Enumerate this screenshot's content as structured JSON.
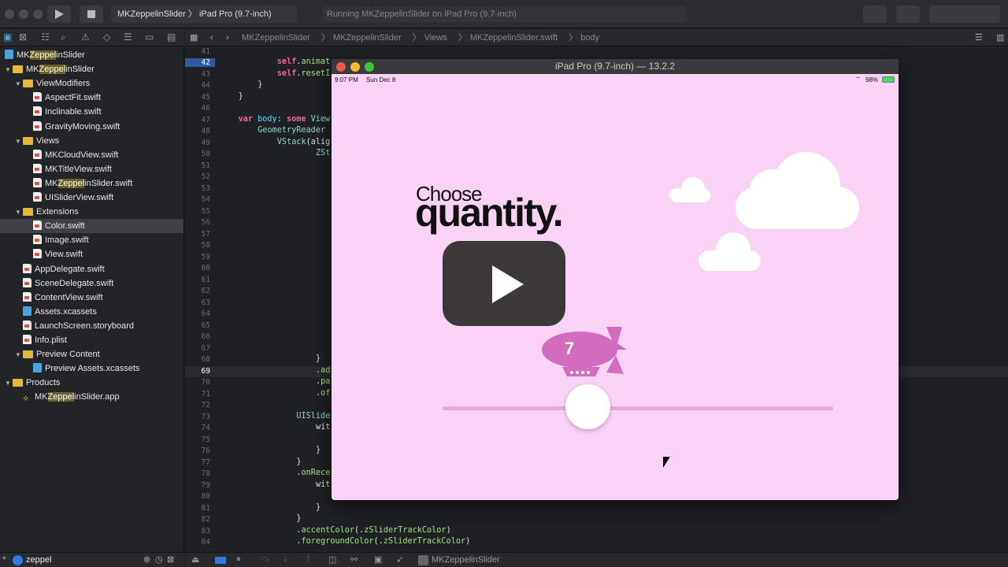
{
  "toolbar": {
    "scheme": "MKZeppelinSlider",
    "device": "iPad Pro (9.7-inch)",
    "activity": "Running MKZeppelinSlider on iPad Pro (9.7-inch)"
  },
  "jumpbar": [
    "MKZeppelinSlider",
    "MKZeppelinSlider",
    "Views",
    "MKZeppelinSlider.swift",
    "body"
  ],
  "navigator": {
    "items": [
      {
        "label": "MKZeppelinSlider",
        "type": "project",
        "level": 0,
        "disc": false
      },
      {
        "label": "MKZeppelinSlider",
        "type": "folder",
        "level": 0,
        "disc": true
      },
      {
        "label": "ViewModifiers",
        "type": "folder",
        "level": 1,
        "disc": true
      },
      {
        "label": "AspectFit.swift",
        "type": "swift",
        "level": 2
      },
      {
        "label": "Inclinable.swift",
        "type": "swift",
        "level": 2
      },
      {
        "label": "GravityMoving.swift",
        "type": "swift",
        "level": 2
      },
      {
        "label": "Views",
        "type": "folder",
        "level": 1,
        "disc": true
      },
      {
        "label": "MKCloudView.swift",
        "type": "swift",
        "level": 2
      },
      {
        "label": "MKTitleView.swift",
        "type": "swift",
        "level": 2
      },
      {
        "label": "MKZeppelinSlider.swift",
        "type": "swift",
        "level": 2
      },
      {
        "label": "UISliderView.swift",
        "type": "swift",
        "level": 2
      },
      {
        "label": "Extensions",
        "type": "folder",
        "level": 1,
        "disc": true
      },
      {
        "label": "Color.swift",
        "type": "swift",
        "level": 2,
        "selected": true
      },
      {
        "label": "Image.swift",
        "type": "swift",
        "level": 2
      },
      {
        "label": "View.swift",
        "type": "swift",
        "level": 2
      },
      {
        "label": "AppDelegate.swift",
        "type": "swift",
        "level": 1
      },
      {
        "label": "SceneDelegate.swift",
        "type": "swift",
        "level": 1
      },
      {
        "label": "ContentView.swift",
        "type": "swift",
        "level": 1
      },
      {
        "label": "Assets.xcassets",
        "type": "blue",
        "level": 1
      },
      {
        "label": "LaunchScreen.storyboard",
        "type": "swift",
        "level": 1
      },
      {
        "label": "Info.plist",
        "type": "swift",
        "level": 1
      },
      {
        "label": "Preview Content",
        "type": "folder",
        "level": 1,
        "disc": true
      },
      {
        "label": "Preview Assets.xcassets",
        "type": "blue",
        "level": 2
      },
      {
        "label": "Products",
        "type": "folder",
        "level": 0,
        "disc": true
      },
      {
        "label": "MKZeppelinSlider.app",
        "type": "app",
        "level": 1
      }
    ],
    "highlight": "Zeppel"
  },
  "filter": {
    "value": "zeppel"
  },
  "editor": {
    "first_line": 41,
    "breakpoint_line": 42,
    "current_line": 69,
    "lines": {
      "42": [
        12,
        "self.animat"
      ],
      "43": [
        12,
        "self.resetI"
      ],
      "44": [
        8,
        "}"
      ],
      "45": [
        4,
        "}"
      ],
      "47": [
        4,
        "var body: some View"
      ],
      "48": [
        8,
        "GeometryReader"
      ],
      "49": [
        12,
        "VStack(alig"
      ],
      "50": [
        20,
        "ZSt"
      ],
      "68": [
        20,
        "}"
      ],
      "69": [
        20,
        ".ad"
      ],
      "70": [
        20,
        ".pa"
      ],
      "71": [
        20,
        ".of"
      ],
      "73": [
        16,
        "UISlide"
      ],
      "74": [
        20,
        "wit"
      ],
      "76": [
        20,
        "}"
      ],
      "77": [
        16,
        "}"
      ],
      "78": [
        16,
        ".onRece"
      ],
      "79": [
        20,
        "wit"
      ],
      "81": [
        20,
        "}"
      ],
      "82": [
        16,
        "}"
      ],
      "83": [
        16,
        ".accentColor(.zSliderTrackColor)"
      ],
      "84": [
        16,
        ".foregroundColor(.zSliderTrackColor)"
      ]
    },
    "last_line": 84
  },
  "debugbar": {
    "target": "MKZeppelinSlider"
  },
  "simulator": {
    "title": "iPad Pro (9.7-inch) — 13.2.2",
    "time": "9:07 PM",
    "date": "Sun Dec 8",
    "battery": "98%",
    "title_line1": "Choose",
    "title_line2": "quantity.",
    "zeppelin_value": "7",
    "slider_fraction": 0.37,
    "background": "#f8d3f4",
    "zeppelin_color": "#d36bbf",
    "track_color": "#e9a6d9"
  }
}
